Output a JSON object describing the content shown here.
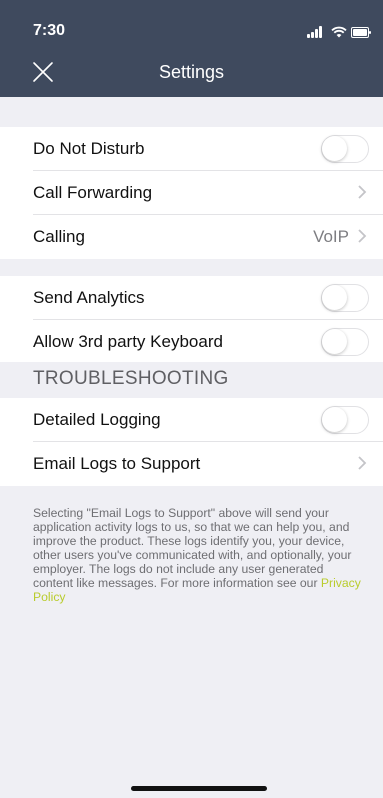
{
  "status_bar": {
    "time": "7:30"
  },
  "header": {
    "title": "Settings",
    "close_icon": "close-icon"
  },
  "section1": {
    "rows": [
      {
        "label": "Do Not Disturb",
        "control": "toggle",
        "on": false
      },
      {
        "label": "Call Forwarding",
        "control": "chevron"
      },
      {
        "label": "Calling",
        "value": "VoIP",
        "control": "chevron"
      }
    ]
  },
  "section2": {
    "rows": [
      {
        "label": "Send Analytics",
        "control": "toggle",
        "on": false
      },
      {
        "label": "Allow 3rd party Keyboard",
        "control": "toggle",
        "on": false
      }
    ]
  },
  "troubleshooting": {
    "header": "TROUBLESHOOTING",
    "rows": [
      {
        "label": "Detailed Logging",
        "control": "toggle",
        "on": false
      },
      {
        "label": "Email Logs to Support",
        "control": "chevron"
      }
    ]
  },
  "footer": {
    "text": "Selecting \"Email Logs to Support\" above will send your application activity logs to us, so that we can help you, and improve the product. These logs identify you, your device, other users you've communicated with, and optionally, your employer. The logs do not include any user generated content like messages. For more information see our ",
    "link": "Privacy Policy"
  },
  "colors": {
    "header_bg": "#3f4a5e",
    "link": "#b9cc2d",
    "background": "#efeff4"
  }
}
